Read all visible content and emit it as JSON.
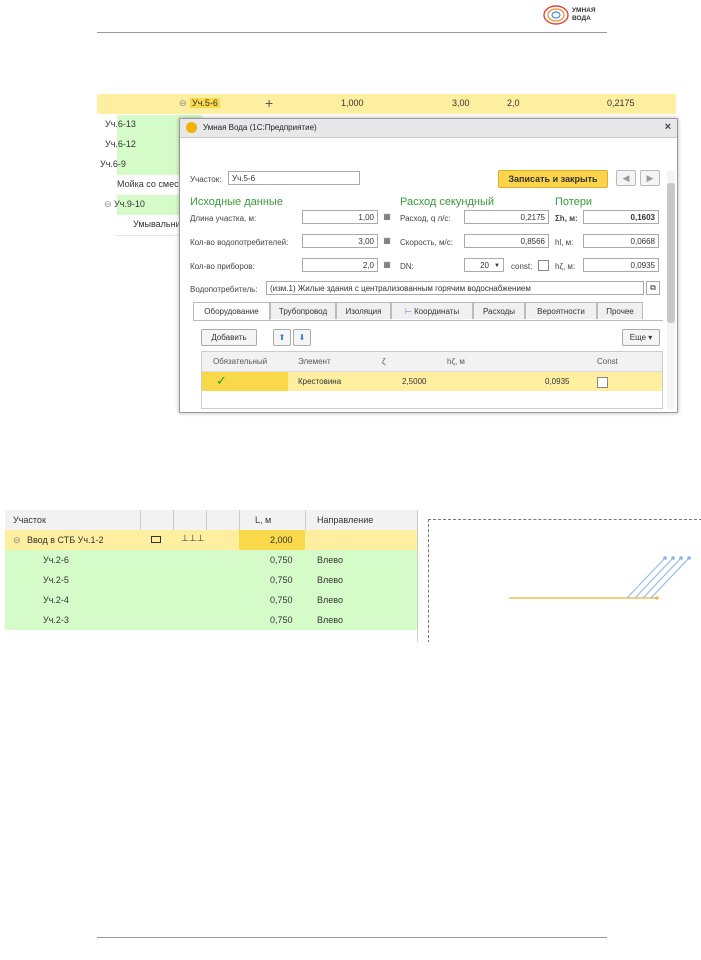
{
  "logo": {
    "line1": "УМНАЯ",
    "line2": "ВОДА"
  },
  "tree": {
    "rows": [
      {
        "name": "Уч.5-6",
        "plus": "+",
        "v1": "1,000",
        "v2": "3,00",
        "v3": "2,0",
        "v4": "0,2175"
      },
      {
        "name": "Уч.6-13"
      },
      {
        "name": "Уч.6-12"
      },
      {
        "name": "Уч.6-9",
        "collapse": "⊖"
      },
      {
        "name": "Мойка со смес"
      },
      {
        "name": "Уч.9-10",
        "collapse": "⊖"
      },
      {
        "name": "Умывальни"
      }
    ],
    "collapse0": "⊖"
  },
  "dialog": {
    "title": "Умная Вода  (1С:Предприятие)",
    "close": "×",
    "uchastok_label": "Участок:",
    "uchastok_value": "Уч.5-6",
    "save_close": "Записать и закрыть",
    "nav_back": "◆",
    "nav_fwd": "➡",
    "sections": {
      "source": "Исходные данные",
      "flow": "Расход секундный",
      "losses": "Потери"
    },
    "fields": {
      "length_label": "Длина участка, м:",
      "length_value": "1,00",
      "consumers_label": "Кол-во водопотребителей:",
      "consumers_value": "3,00",
      "devices_label": "Кол-во приборов:",
      "devices_value": "2,0",
      "flow_label": "Расход, q л/с:",
      "flow_value": "0,2175",
      "speed_label": "Скорость, м/с:",
      "speed_value": "0,8566",
      "dn_label": "DN:",
      "dn_value": "20",
      "const_label": "const:",
      "sum_h_label": "Σh, м:",
      "sum_h_value": "0,1603",
      "hl_label": "hl, м:",
      "hl_value": "0,0668",
      "hz_label": "hζ, м:",
      "hz_value": "0,0935",
      "consumer_label": "Водопотребитель:",
      "consumer_value": "(изм.1) Жилые здания с централизованным горячим водоснабжением"
    },
    "tabs": [
      "Оборудование",
      "Трубопровод",
      "Изоляция",
      "Координаты",
      "Расходы",
      "Вероятности",
      "Прочее"
    ],
    "add_button": "Добавить",
    "more_button": "Еще ▾",
    "grid_headers": [
      "Обязательный",
      "Элемент",
      "ζ",
      "hζ, м",
      "Const"
    ],
    "grid_row": {
      "check": "✓",
      "element": "Крестовина",
      "zeta": "2,5000",
      "hz": "0,0935"
    }
  },
  "table2": {
    "headers": {
      "section": "Участок",
      "length": "L, м",
      "direction": "Направление"
    },
    "rows": [
      {
        "name": "Ввод в СТБ Уч.1-2",
        "collapse": "⊖",
        "length": "2,000",
        "direction": ""
      },
      {
        "name": "Уч.2-6",
        "length": "0,750",
        "direction": "Влево"
      },
      {
        "name": "Уч.2-5",
        "length": "0,750",
        "direction": "Влево"
      },
      {
        "name": "Уч.2-4",
        "length": "0,750",
        "direction": "Влево"
      },
      {
        "name": "Уч.2-3",
        "length": "0,750",
        "direction": "Влево"
      }
    ]
  },
  "colors": {
    "selected_row": "#fdeea0",
    "green_row": "#d5fcc8",
    "accent_yellow": "#fbd44b",
    "header_green": "#3a9a3a"
  }
}
